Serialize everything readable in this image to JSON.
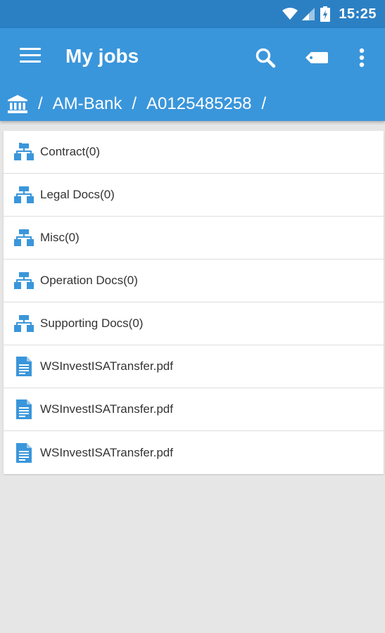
{
  "status_bar": {
    "time": "15:25"
  },
  "app_bar": {
    "title": "My jobs"
  },
  "breadcrumb": {
    "first": "AM-Bank",
    "second": "A0125485258",
    "separator": "/"
  },
  "items": [
    {
      "label": "Contract(0)",
      "icon": "folder-tree-icon"
    },
    {
      "label": "Legal Docs(0)",
      "icon": "folder-tree-icon"
    },
    {
      "label": "Misc(0)",
      "icon": "folder-tree-icon"
    },
    {
      "label": "Operation Docs(0)",
      "icon": "folder-tree-icon"
    },
    {
      "label": "Supporting Docs(0)",
      "icon": "folder-tree-icon"
    },
    {
      "label": "WSInvestISATransfer.pdf",
      "icon": "document-icon"
    },
    {
      "label": "WSInvestISATransfer.pdf",
      "icon": "document-icon"
    },
    {
      "label": "WSInvestISATransfer.pdf",
      "icon": "document-icon"
    }
  ],
  "colors": {
    "status_bar": "#2b80c4",
    "app_bar": "#3a96db",
    "icon_blue": "#3a96db",
    "background": "#e6e6e6"
  }
}
